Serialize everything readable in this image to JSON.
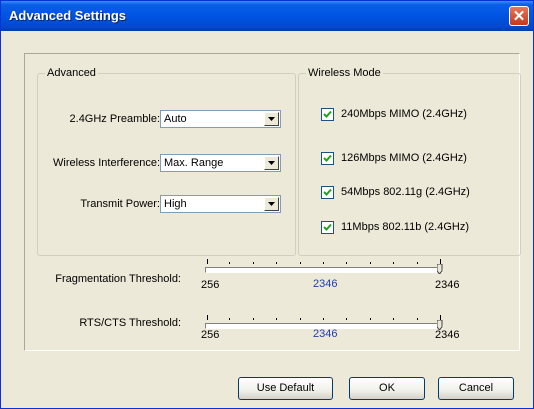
{
  "window": {
    "title": "Advanced Settings",
    "close_glyph": "✕"
  },
  "advanced": {
    "legend": "Advanced",
    "preamble": {
      "label": "2.4GHz Preamble:",
      "value": "Auto"
    },
    "interference": {
      "label": "Wireless Interference:",
      "value": "Max. Range"
    },
    "power": {
      "label": "Transmit Power:",
      "value": "High"
    }
  },
  "wireless_mode": {
    "legend": "Wireless Mode",
    "items": [
      {
        "label": "240Mbps MIMO (2.4GHz)",
        "checked": true
      },
      {
        "label": "126Mbps MIMO (2.4GHz)",
        "checked": true
      },
      {
        "label": "54Mbps 802.11g (2.4GHz)",
        "checked": true
      },
      {
        "label": "11Mbps 802.11b (2.4GHz)",
        "checked": true
      }
    ]
  },
  "fragmentation": {
    "label": "Fragmentation Threshold:",
    "min": "256",
    "current": "2346",
    "max": "2346"
  },
  "rts": {
    "label": "RTS/CTS Threshold:",
    "min": "256",
    "current": "2346",
    "max": "2346"
  },
  "buttons": {
    "use_default": "Use Default",
    "ok": "OK",
    "cancel": "Cancel"
  },
  "icons": {
    "dropdown": "chevron-down-icon",
    "check": "check-icon",
    "close": "close-icon"
  }
}
